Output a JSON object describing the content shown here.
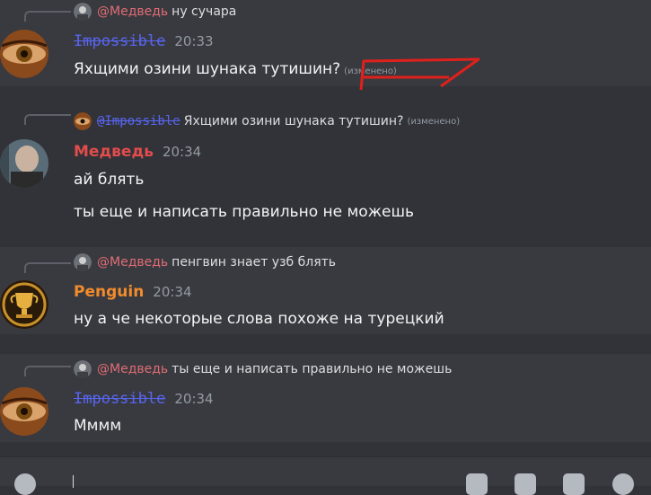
{
  "messages": [
    {
      "reply_mention": "@Медведь",
      "reply_text": "ну сучара",
      "author": "Impossible",
      "time": "20:33",
      "lines": [
        "Яхщими озини шунака тутишин?"
      ],
      "edited": "(изменено)"
    },
    {
      "reply_mention": "@Impossible",
      "reply_text": "Яхщими озини шунака тутишин?",
      "reply_edited": "(изменено)",
      "author": "Медведь",
      "time": "20:34",
      "lines": [
        "ай блять",
        "ты еще и написать правильно не можешь"
      ]
    },
    {
      "reply_mention": "@Медведь",
      "reply_text": "пенгвин знает узб блять",
      "author": "Penguin",
      "time": "20:34",
      "lines": [
        "ну а че некоторые слова похоже на турецкий"
      ]
    },
    {
      "reply_mention": "@Медведь",
      "reply_text": "ты еще и написать правильно не можешь",
      "author": "Impossible",
      "time": "20:34",
      "lines": [
        "Мммм"
      ]
    }
  ],
  "colors": {
    "background": "#313338",
    "highlight": "#393a3f",
    "mention_red": "#e06c75",
    "impossible_blue": "#5865f2",
    "medved_red": "#e24c4c",
    "penguin_orange": "#f28b2b",
    "annotation_red": "#e0201b"
  },
  "icons": [
    "reply-spine",
    "avatar-eye",
    "avatar-man",
    "avatar-trophy",
    "plus-icon",
    "gift-icon",
    "gif-icon",
    "sticker-icon",
    "emoji-icon"
  ]
}
